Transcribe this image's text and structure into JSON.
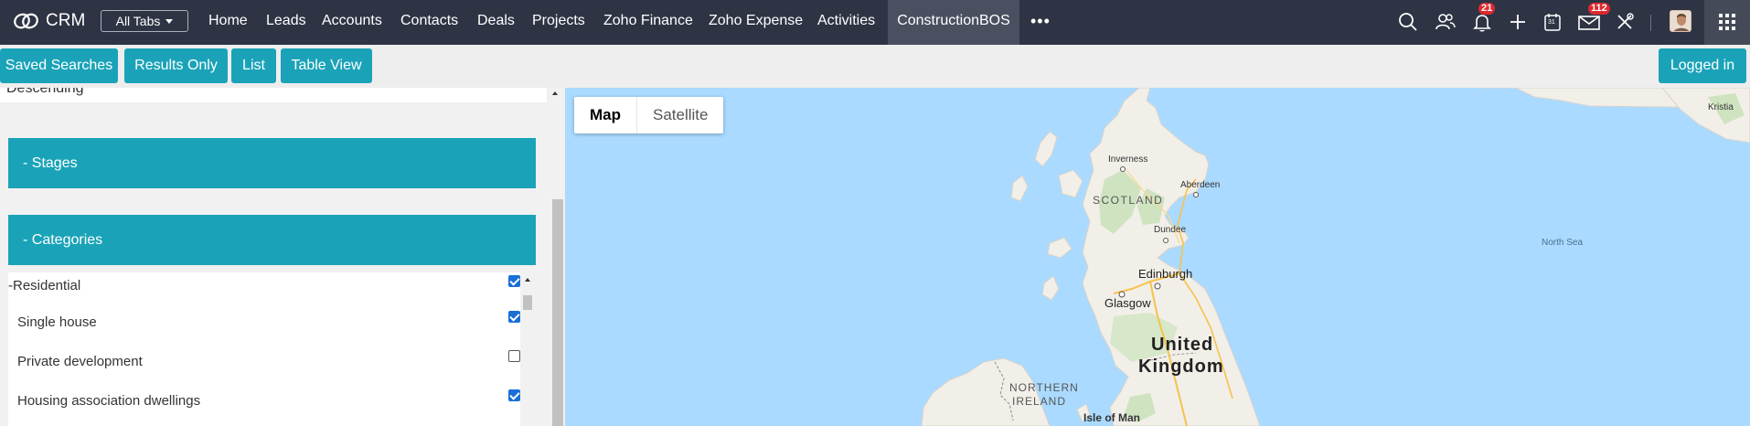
{
  "app": {
    "name": "CRM"
  },
  "nav": {
    "all_tabs": "All Tabs",
    "tabs": [
      {
        "label": "Home"
      },
      {
        "label": "Leads"
      },
      {
        "label": "Accounts"
      },
      {
        "label": "Contacts"
      },
      {
        "label": "Deals"
      },
      {
        "label": "Projects"
      },
      {
        "label": "Zoho Finance"
      },
      {
        "label": "Zoho Expense"
      },
      {
        "label": "Activities"
      },
      {
        "label": "ConstructionBOS",
        "active": true
      }
    ],
    "more": "•••",
    "notifications_count": "21",
    "mail_count": "112",
    "icons": [
      "search-icon",
      "contacts-icon",
      "bell-icon",
      "plus-icon",
      "calendar-icon",
      "mail-icon",
      "tools-icon",
      "avatar",
      "app-grid-icon"
    ],
    "calendar_day": "31"
  },
  "toolbar": {
    "saved_searches": "Saved Searches",
    "results_only": "Results Only",
    "list": "List",
    "table_view": "Table View",
    "logged_in": "Logged in"
  },
  "panel": {
    "sort_text": "Descending",
    "stages_header": "- Stages",
    "categories_header": "- Categories",
    "categories": [
      {
        "label": "-Residential",
        "checked": true
      },
      {
        "label": "Single house",
        "checked": true
      },
      {
        "label": "Private development",
        "checked": false
      },
      {
        "label": "Housing association dwellings",
        "checked": true
      }
    ]
  },
  "map": {
    "toggle_map": "Map",
    "toggle_satellite": "Satellite",
    "labels": {
      "inverness": "Inverness",
      "aberdeen": "Aberdeen",
      "scotland": "SCOTLAND",
      "dundee": "Dundee",
      "north_sea": "North Sea",
      "edinburgh": "Edinburgh",
      "glasgow": "Glasgow",
      "united": "United",
      "kingdom": "Kingdom",
      "northern": "NORTHERN",
      "ireland": "IRELAND",
      "isle_of_man": "Isle of Man",
      "kristi": "Kristia"
    }
  },
  "colors": {
    "nav_bg": "#2e3444",
    "accent": "#1aa3b8",
    "water": "#aadaff",
    "land": "#f2efe9",
    "badge": "#e0282e"
  }
}
